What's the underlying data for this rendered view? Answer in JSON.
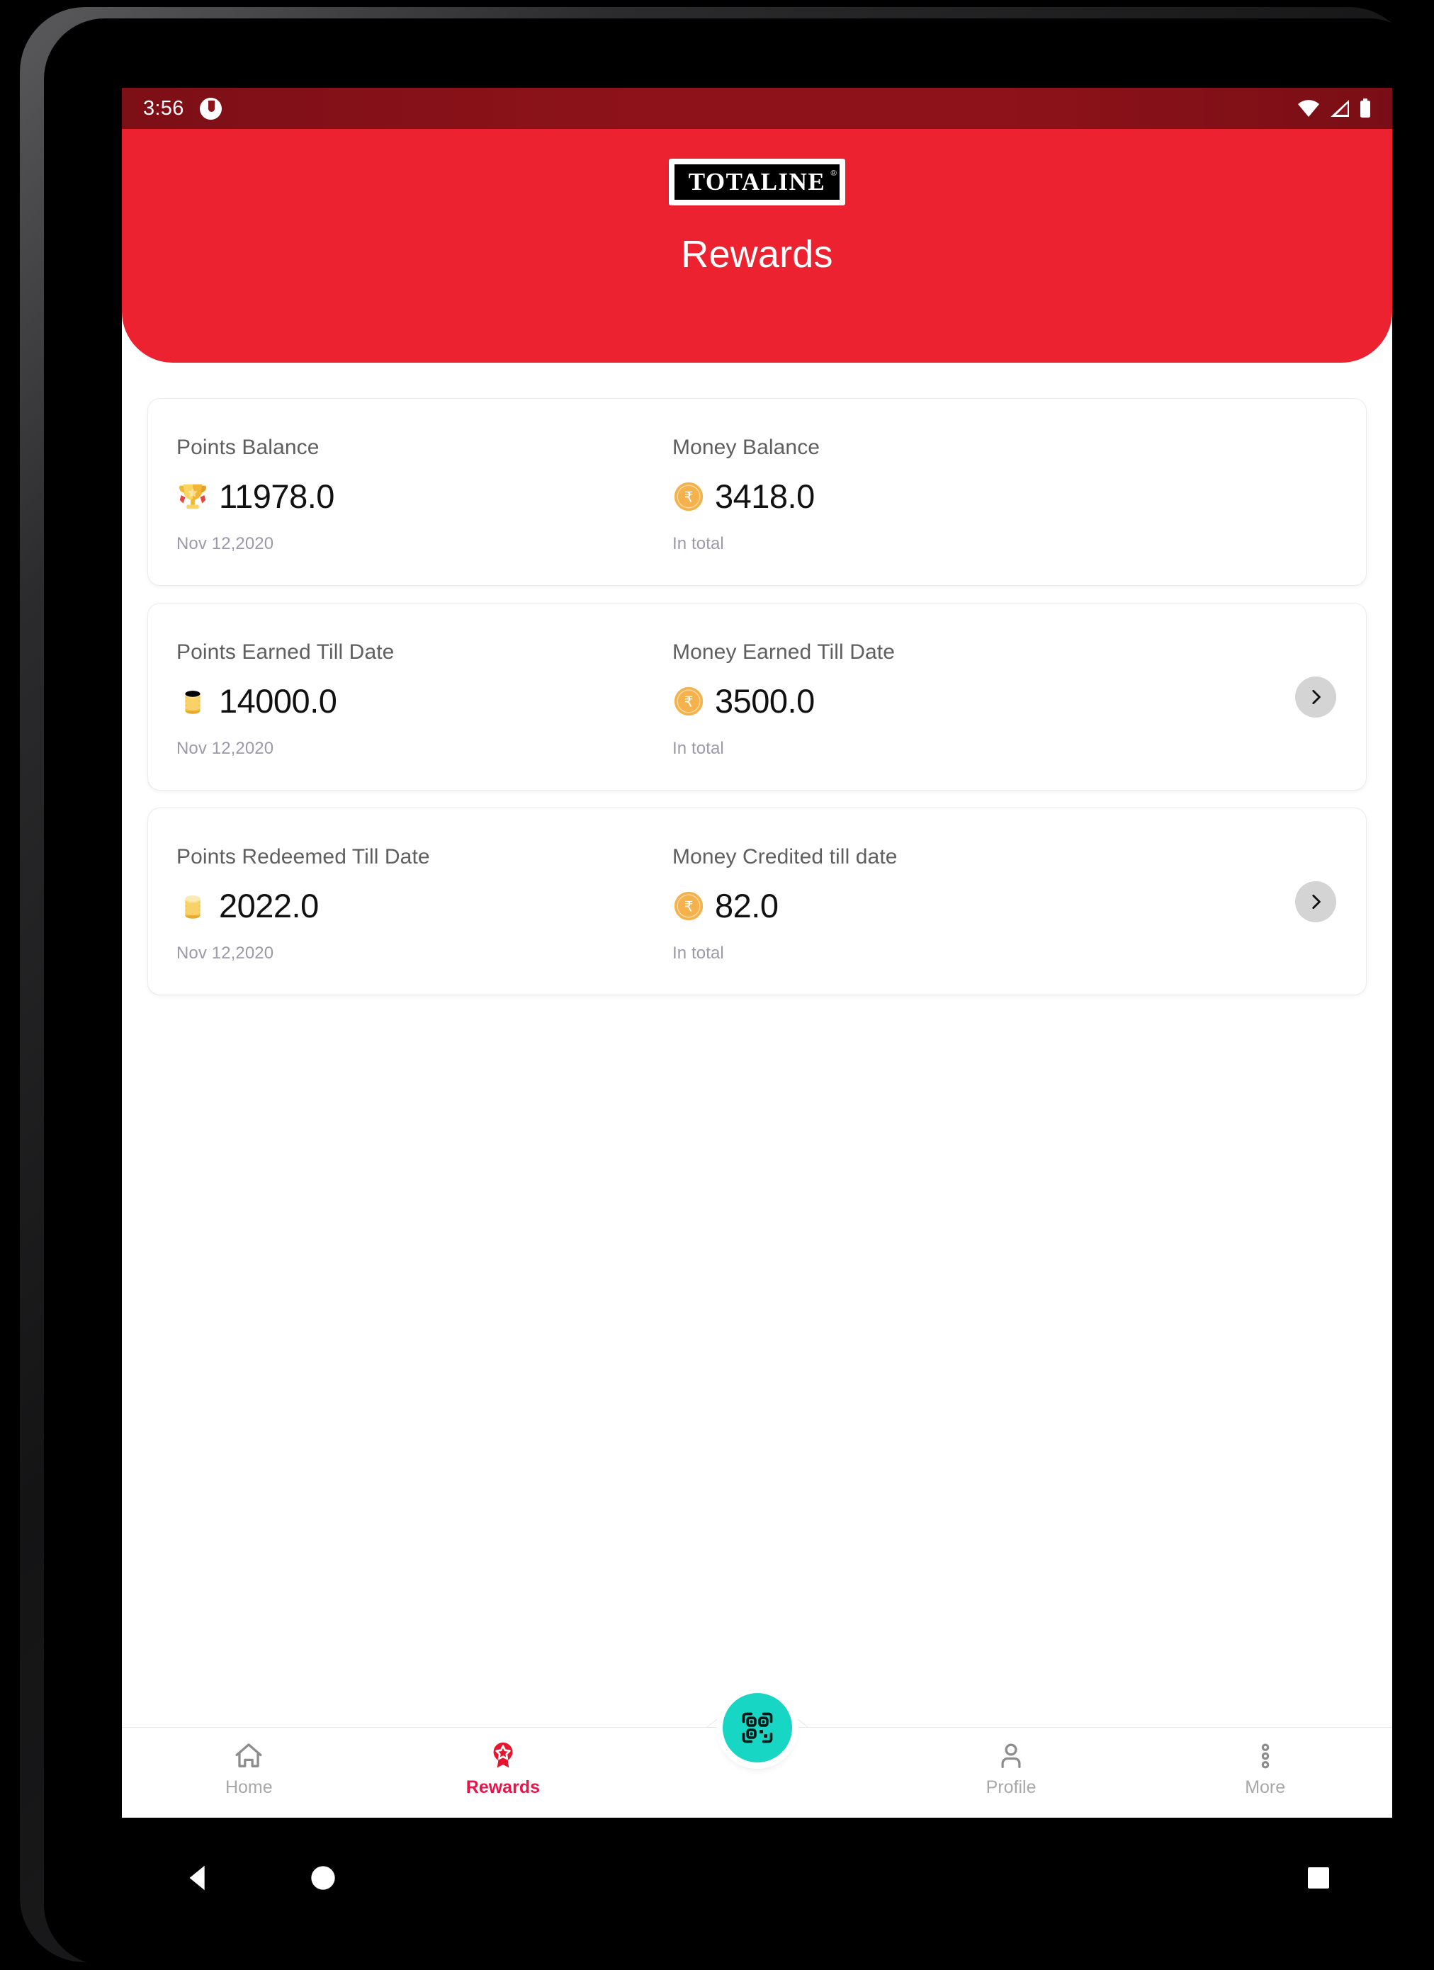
{
  "status_bar": {
    "time": "3:56",
    "notification_icon": "circle-notification-icon",
    "wifi_icon": "wifi-icon",
    "signal_icon": "cellular-signal-icon",
    "battery_icon": "battery-full-icon",
    "background_color": "#8d1219"
  },
  "header": {
    "logo_text": "TOTALINE",
    "logo_registered": "®",
    "title": "Rewards",
    "background_color": "#ec2230"
  },
  "cards": [
    {
      "left": {
        "label": "Points Balance",
        "icon": "trophy-icon",
        "value": "11978.0",
        "sub": "Nov 12,2020"
      },
      "right": {
        "label": "Money Balance",
        "icon": "rupee-coin-icon",
        "value": "3418.0",
        "sub": "In total"
      },
      "has_chevron": false
    },
    {
      "left": {
        "label": "Points Earned Till Date",
        "icon": "coin-stack-icon",
        "value": "14000.0",
        "sub": "Nov 12,2020"
      },
      "right": {
        "label": "Money Earned Till Date",
        "icon": "rupee-coin-icon",
        "value": "3500.0",
        "sub": "In total"
      },
      "has_chevron": true
    },
    {
      "left": {
        "label": "Points Redeemed Till Date",
        "icon": "coin-stack-icon",
        "value": "2022.0",
        "sub": "Nov 12,2020"
      },
      "right": {
        "label": "Money Credited till date",
        "icon": "rupee-coin-icon",
        "value": "82.0",
        "sub": "In total"
      },
      "has_chevron": true
    }
  ],
  "fab": {
    "icon": "qr-code-scan-icon",
    "color": "#17d6c4"
  },
  "bottom_nav": {
    "active_color": "#e8154b",
    "inactive_color": "#a8a8a8",
    "items": [
      {
        "label": "Home",
        "icon": "home-icon",
        "active": false
      },
      {
        "label": "Rewards",
        "icon": "reward-badge-icon",
        "active": true
      },
      {
        "label": "Profile",
        "icon": "person-icon",
        "active": false
      },
      {
        "label": "More",
        "icon": "more-vertical-icon",
        "active": false
      }
    ]
  },
  "system_nav": {
    "back": "back-triangle-icon",
    "home": "home-circle-icon",
    "recents": "recents-square-icon"
  }
}
